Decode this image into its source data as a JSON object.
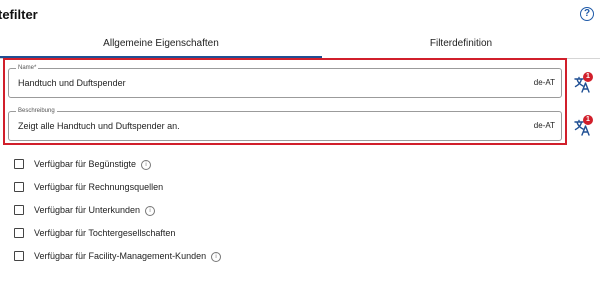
{
  "header": {
    "title": "tefilter",
    "help_icon": "question-circle-icon"
  },
  "tabs": [
    {
      "label": "Allgemeine Eigenschaften",
      "active": true
    },
    {
      "label": "Filterdefinition",
      "active": false
    }
  ],
  "fields": {
    "name": {
      "label": "Name*",
      "value": "Handtuch und Duftspender",
      "lang": "de-AT"
    },
    "description": {
      "label": "Beschreibung",
      "value": "Zeigt alle Handtuch und Duftspender an.",
      "lang": "de-AT"
    }
  },
  "translate_badges": [
    "1",
    "1"
  ],
  "checkboxes": [
    {
      "label": "Verfügbar für Begünstigte",
      "checked": false,
      "info": true
    },
    {
      "label": "Verfügbar für Rechnungsquellen",
      "checked": false,
      "info": false
    },
    {
      "label": "Verfügbar für Unterkunden",
      "checked": false,
      "info": true
    },
    {
      "label": "Verfügbar für Tochtergesellschaften",
      "checked": false,
      "info": false
    },
    {
      "label": "Verfügbar für Facility-Management-Kunden",
      "checked": false,
      "info": true
    }
  ],
  "colors": {
    "accent": "#1f4f93",
    "highlight": "#d11f2b",
    "badge": "#d11f2b"
  }
}
